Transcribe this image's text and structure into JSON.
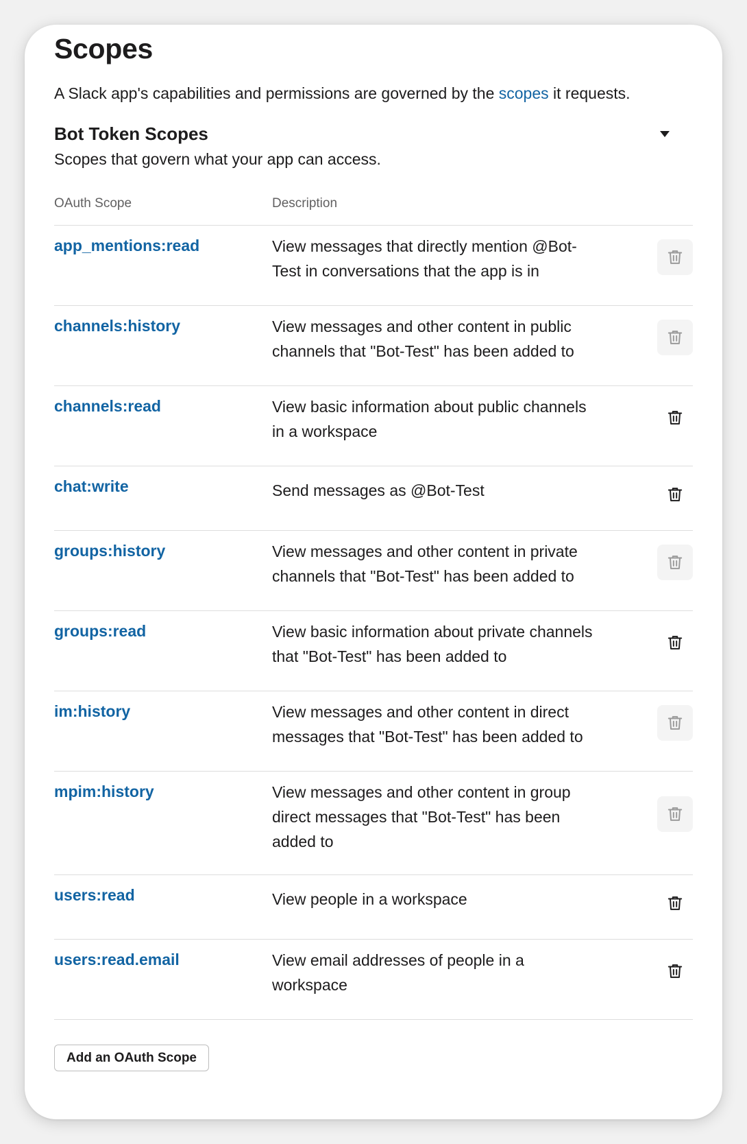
{
  "header": {
    "title": "Scopes",
    "intro_before": "A Slack app's capabilities and permissions are governed by the ",
    "intro_link": "scopes",
    "intro_after": " it requests."
  },
  "section": {
    "title": "Bot Token Scopes",
    "description": "Scopes that govern what your app can access.",
    "collapse_icon": "caret-down-icon"
  },
  "table": {
    "columns": [
      "OAuth Scope",
      "Description"
    ],
    "rows": [
      {
        "scope": "app_mentions:read",
        "description": "View messages that directly mention @Bot-Test in conversations that the app is in",
        "delete_disabled": true
      },
      {
        "scope": "channels:history",
        "description": "View messages and other content in public channels that \"Bot-Test\" has been added to",
        "delete_disabled": true
      },
      {
        "scope": "channels:read",
        "description": "View basic information about public channels in a workspace",
        "delete_disabled": false
      },
      {
        "scope": "chat:write",
        "description": "Send messages as @Bot-Test",
        "delete_disabled": false
      },
      {
        "scope": "groups:history",
        "description": "View messages and other content in private channels that \"Bot-Test\" has been added to",
        "delete_disabled": true
      },
      {
        "scope": "groups:read",
        "description": "View basic information about private channels that \"Bot-Test\" has been added to",
        "delete_disabled": false
      },
      {
        "scope": "im:history",
        "description": "View messages and other content in direct messages that \"Bot-Test\" has been added to",
        "delete_disabled": true
      },
      {
        "scope": "mpim:history",
        "description": "View messages and other content in group direct messages that \"Bot-Test\" has been added to",
        "delete_disabled": true
      },
      {
        "scope": "users:read",
        "description": "View people in a workspace",
        "delete_disabled": false
      },
      {
        "scope": "users:read.email",
        "description": "View email addresses of people in a workspace",
        "delete_disabled": false
      }
    ],
    "delete_icon": "trash-icon"
  },
  "actions": {
    "add_scope_label": "Add an OAuth Scope"
  },
  "colors": {
    "link": "#1264a3",
    "text": "#1d1c1d",
    "muted": "#616061",
    "icon_enabled": "#1d1c1d",
    "icon_disabled": "#9a9a9a",
    "disabled_bg": "#f4f4f4",
    "divider": "#dddddd"
  }
}
